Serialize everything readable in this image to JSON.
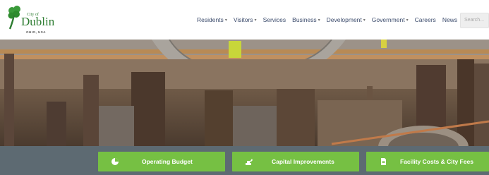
{
  "logo": {
    "small_text": "City of",
    "name": "Dublin",
    "sub_text": "OHIO, USA",
    "icon": "shamrock-icon",
    "color": "#2e7d32"
  },
  "nav": {
    "items": [
      {
        "label": "Residents",
        "dropdown": true
      },
      {
        "label": "Visitors",
        "dropdown": true
      },
      {
        "label": "Services",
        "dropdown": false
      },
      {
        "label": "Business",
        "dropdown": true
      },
      {
        "label": "Development",
        "dropdown": true
      },
      {
        "label": "Government",
        "dropdown": true
      },
      {
        "label": "Careers",
        "dropdown": false
      },
      {
        "label": "News",
        "dropdown": false
      }
    ],
    "chevron": "▾"
  },
  "search": {
    "placeholder": "Search..."
  },
  "quick_links": [
    {
      "label": "Operating Budget",
      "icon": "pie-chart-icon"
    },
    {
      "label": "Capital Improvements",
      "icon": "excavator-icon"
    },
    {
      "label": "Facility Costs & City Fees",
      "icon": "document-icon"
    }
  ],
  "colors": {
    "nav_text": "#3a4a6b",
    "button_green": "#76c043",
    "bar_gray": "#5d6a72"
  }
}
